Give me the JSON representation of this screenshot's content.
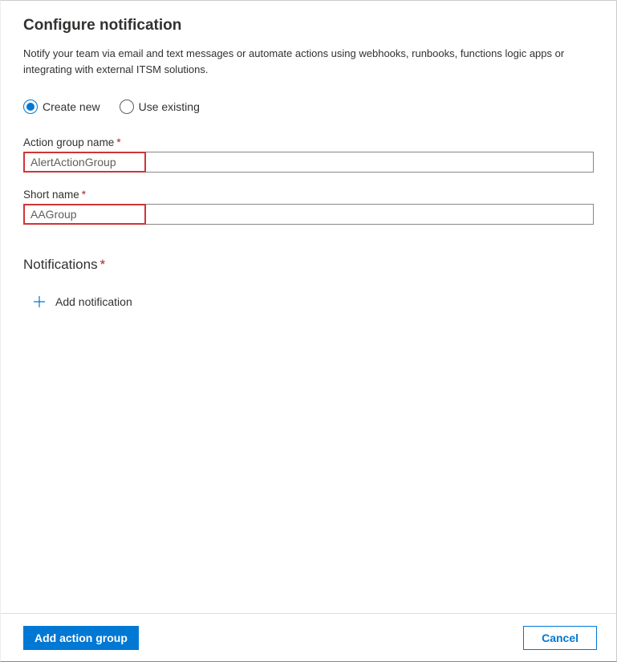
{
  "header": {
    "title": "Configure notification",
    "subtitle": "Notify your team via email and text messages or automate actions using webhooks, runbooks, functions logic apps or integrating with external ITSM solutions."
  },
  "radio": {
    "create_new": "Create new",
    "use_existing": "Use existing",
    "selected": "create_new"
  },
  "fields": {
    "action_group_name": {
      "label": "Action group name",
      "value": "AlertActionGroup",
      "highlight_width": 153
    },
    "short_name": {
      "label": "Short name",
      "value": "AAGroup",
      "highlight_width": 153
    }
  },
  "notifications": {
    "heading": "Notifications",
    "add_label": "Add notification"
  },
  "footer": {
    "primary": "Add action group",
    "secondary": "Cancel"
  }
}
